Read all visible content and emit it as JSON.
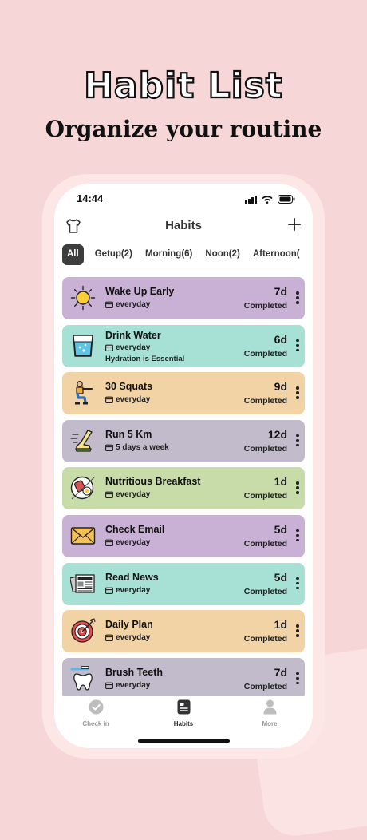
{
  "promo": {
    "headline": "Habit List",
    "subline": "Organize your routine"
  },
  "status_bar": {
    "time": "14:44"
  },
  "header": {
    "title": "Habits",
    "left_icon": "shirt-icon",
    "right_icon": "plus-icon"
  },
  "tabs": [
    {
      "label": "All",
      "active": true
    },
    {
      "label": "Getup(2)"
    },
    {
      "label": "Morning(6)"
    },
    {
      "label": "Noon(2)"
    },
    {
      "label": "Afternoon("
    }
  ],
  "habits": [
    {
      "name": "Wake Up Early",
      "freq": "everyday",
      "days": "7d",
      "status": "Completed",
      "color": "#c9b1d5",
      "icon": "sun-icon"
    },
    {
      "name": "Drink Water",
      "freq": "everyday",
      "note": "Hydration is Essential",
      "days": "6d",
      "status": "Completed",
      "color": "#a7e0d4",
      "icon": "water-glass-icon"
    },
    {
      "name": "30 Squats",
      "freq": "everyday",
      "days": "9d",
      "status": "Completed",
      "color": "#f1d3a6",
      "icon": "squat-person-icon"
    },
    {
      "name": "Run 5 Km",
      "freq": "5 days a week",
      "days": "12d",
      "status": "Completed",
      "color": "#c2bbcb",
      "icon": "running-shoe-icon"
    },
    {
      "name": "Nutritious Breakfast",
      "freq": "everyday",
      "days": "1d",
      "status": "Completed",
      "color": "#c7dca9",
      "icon": "breakfast-plate-icon"
    },
    {
      "name": "Check Email",
      "freq": "everyday",
      "days": "5d",
      "status": "Completed",
      "color": "#c9b1d5",
      "icon": "envelope-icon"
    },
    {
      "name": "Read News",
      "freq": "everyday",
      "days": "5d",
      "status": "Completed",
      "color": "#a7e0d4",
      "icon": "newspaper-icon"
    },
    {
      "name": "Daily Plan",
      "freq": "everyday",
      "days": "1d",
      "status": "Completed",
      "color": "#f1d3a6",
      "icon": "target-icon"
    },
    {
      "name": "Brush Teeth",
      "freq": "everyday",
      "days": "7d",
      "status": "Completed",
      "color": "#c2bbcb",
      "icon": "tooth-brush-icon"
    }
  ],
  "tabbar": [
    {
      "label": "Check in",
      "icon": "check-circle-icon"
    },
    {
      "label": "Habits",
      "icon": "habits-card-icon",
      "active": true
    },
    {
      "label": "More",
      "icon": "person-icon"
    }
  ]
}
